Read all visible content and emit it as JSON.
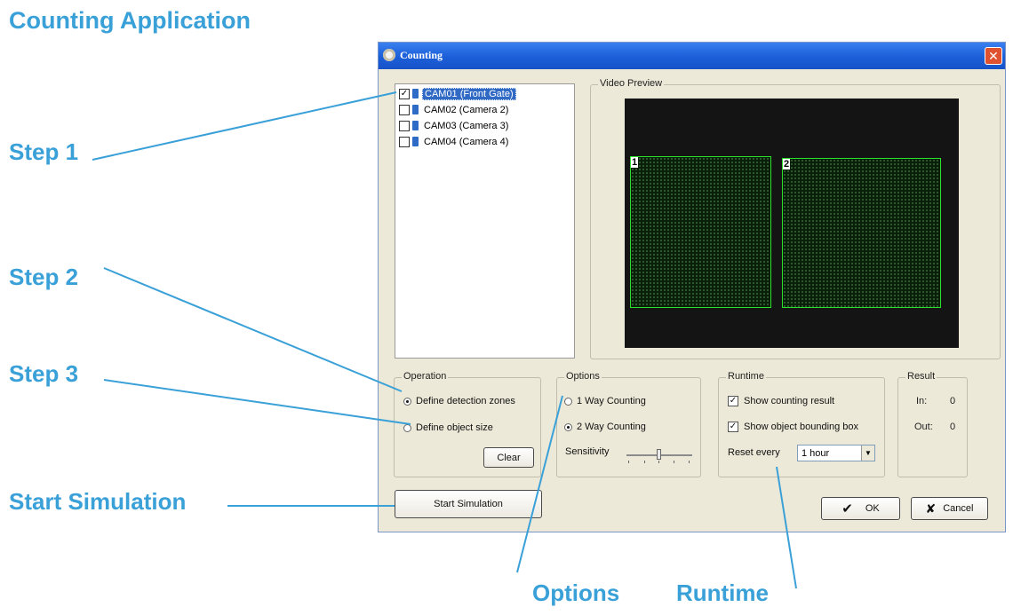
{
  "annotations": {
    "heading": "Counting Application",
    "step1": "Step 1",
    "step2": "Step 2",
    "step3": "Step 3",
    "start_simulation": "Start Simulation",
    "options": "Options",
    "runtime": "Runtime"
  },
  "window": {
    "title": "Counting",
    "close_glyph": "✕"
  },
  "cameras": [
    {
      "label": "CAM01 (Front Gate)",
      "checked": true,
      "selected": true
    },
    {
      "label": "CAM02 (Camera 2)",
      "checked": false
    },
    {
      "label": "CAM03 (Camera 3)",
      "checked": false
    },
    {
      "label": "CAM04 (Camera 4)",
      "checked": false
    }
  ],
  "video_preview": {
    "title": "Video Preview",
    "zones": [
      "1",
      "2"
    ]
  },
  "operation": {
    "title": "Operation",
    "define_detection_zones": "Define detection zones",
    "define_object_size": "Define object size",
    "selected": "define_detection_zones",
    "clear_label": "Clear"
  },
  "options": {
    "title": "Options",
    "one_way": "1 Way Counting",
    "two_way": "2 Way Counting",
    "selected": "two_way",
    "sensitivity_label": "Sensitivity"
  },
  "runtime": {
    "title": "Runtime",
    "show_counting_result": "Show counting result",
    "show_bounding_box": "Show object bounding box",
    "show_counting_result_checked": true,
    "show_bounding_box_checked": true,
    "reset_every_label": "Reset every",
    "reset_every_value": "1 hour"
  },
  "result": {
    "title": "Result",
    "in_label": "In:",
    "in_value": "0",
    "out_label": "Out:",
    "out_value": "0"
  },
  "buttons": {
    "start_simulation": "Start Simulation",
    "ok": "OK",
    "ok_icon": "✔",
    "cancel": "Cancel",
    "cancel_icon": "✘"
  },
  "colors": {
    "annotation": "#3aa0d8",
    "zone_border": "#2ee02e",
    "title_bar": "#1b5ed8"
  },
  "icons": [
    "app-icon",
    "close-icon",
    "camera-icon",
    "checkmark-icon",
    "cross-icon",
    "dropdown-arrow-icon"
  ]
}
